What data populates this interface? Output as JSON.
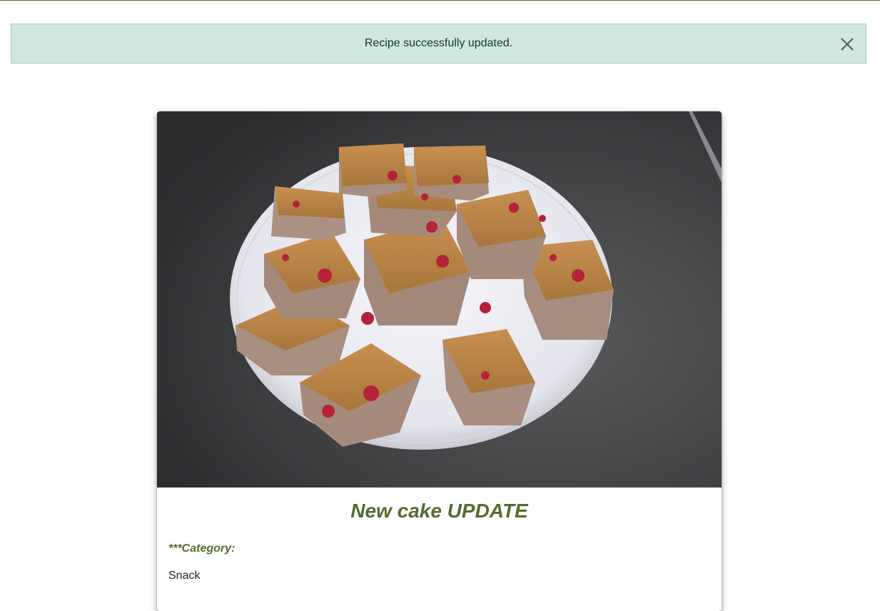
{
  "alert": {
    "message": "Recipe successfully updated.",
    "close_icon": "close-icon"
  },
  "recipe": {
    "image_icon": "cake-photo",
    "title": "New cake UPDATE",
    "category_label": "***Category:",
    "category_value": "Snack"
  },
  "colors": {
    "accent": "#556b2f",
    "alert_bg": "#d1e7dd",
    "alert_border": "#a3cfbb"
  }
}
